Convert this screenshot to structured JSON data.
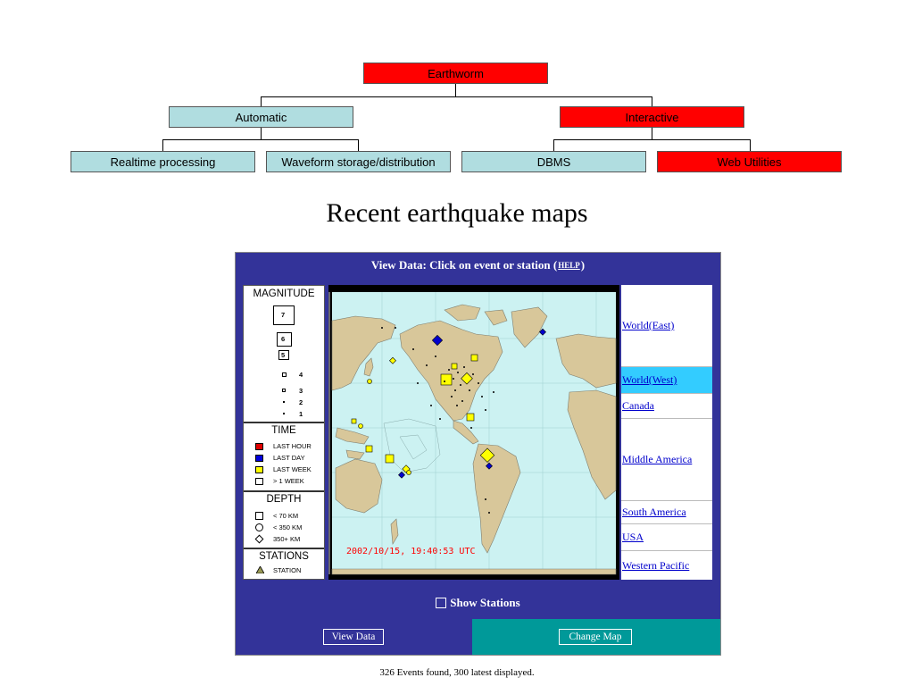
{
  "tree": {
    "root": "Earthworm",
    "level1": [
      "Automatic",
      "Interactive"
    ],
    "level2": [
      "Realtime processing",
      "Waveform storage/distribution",
      "DBMS",
      "Web Utilities"
    ]
  },
  "slide_title": "Recent earthquake maps",
  "app": {
    "header_pre": "View Data: Click on event or station (",
    "header_help": "HELP",
    "header_post": ")",
    "legend": {
      "magnitude_title": "MAGNITUDE",
      "magnitudes": [
        "7",
        "6",
        "5",
        "4",
        "3",
        "2",
        "1"
      ],
      "time_title": "TIME",
      "time_items": [
        "LAST HOUR",
        "LAST DAY",
        "LAST WEEK",
        "> 1 WEEK"
      ],
      "time_colors": [
        "#e00000",
        "#0000dd",
        "#ffff00",
        "#ffffff"
      ],
      "depth_title": "DEPTH",
      "depth_items": [
        "< 70  KM",
        "< 350 KM",
        "350+ KM"
      ],
      "stations_title": "STATIONS",
      "station_item": "STATION"
    },
    "map_timestamp": "2002/10/15, 19:40:53 UTC",
    "regions": [
      "World(East)",
      "World(West)",
      "Canada",
      "Middle America",
      "South America",
      "USA",
      "Western Pacific"
    ],
    "active_region": "World(West)",
    "show_stations_label": "Show Stations",
    "view_data_button": "View Data",
    "change_map_button": "Change Map",
    "colors": {
      "panel": "#333399",
      "teal": "#009999",
      "active": "#33ccff",
      "red": "#ff0000",
      "node": "#b0dde0"
    }
  },
  "footer": "326 Events found, 300 latest displayed."
}
